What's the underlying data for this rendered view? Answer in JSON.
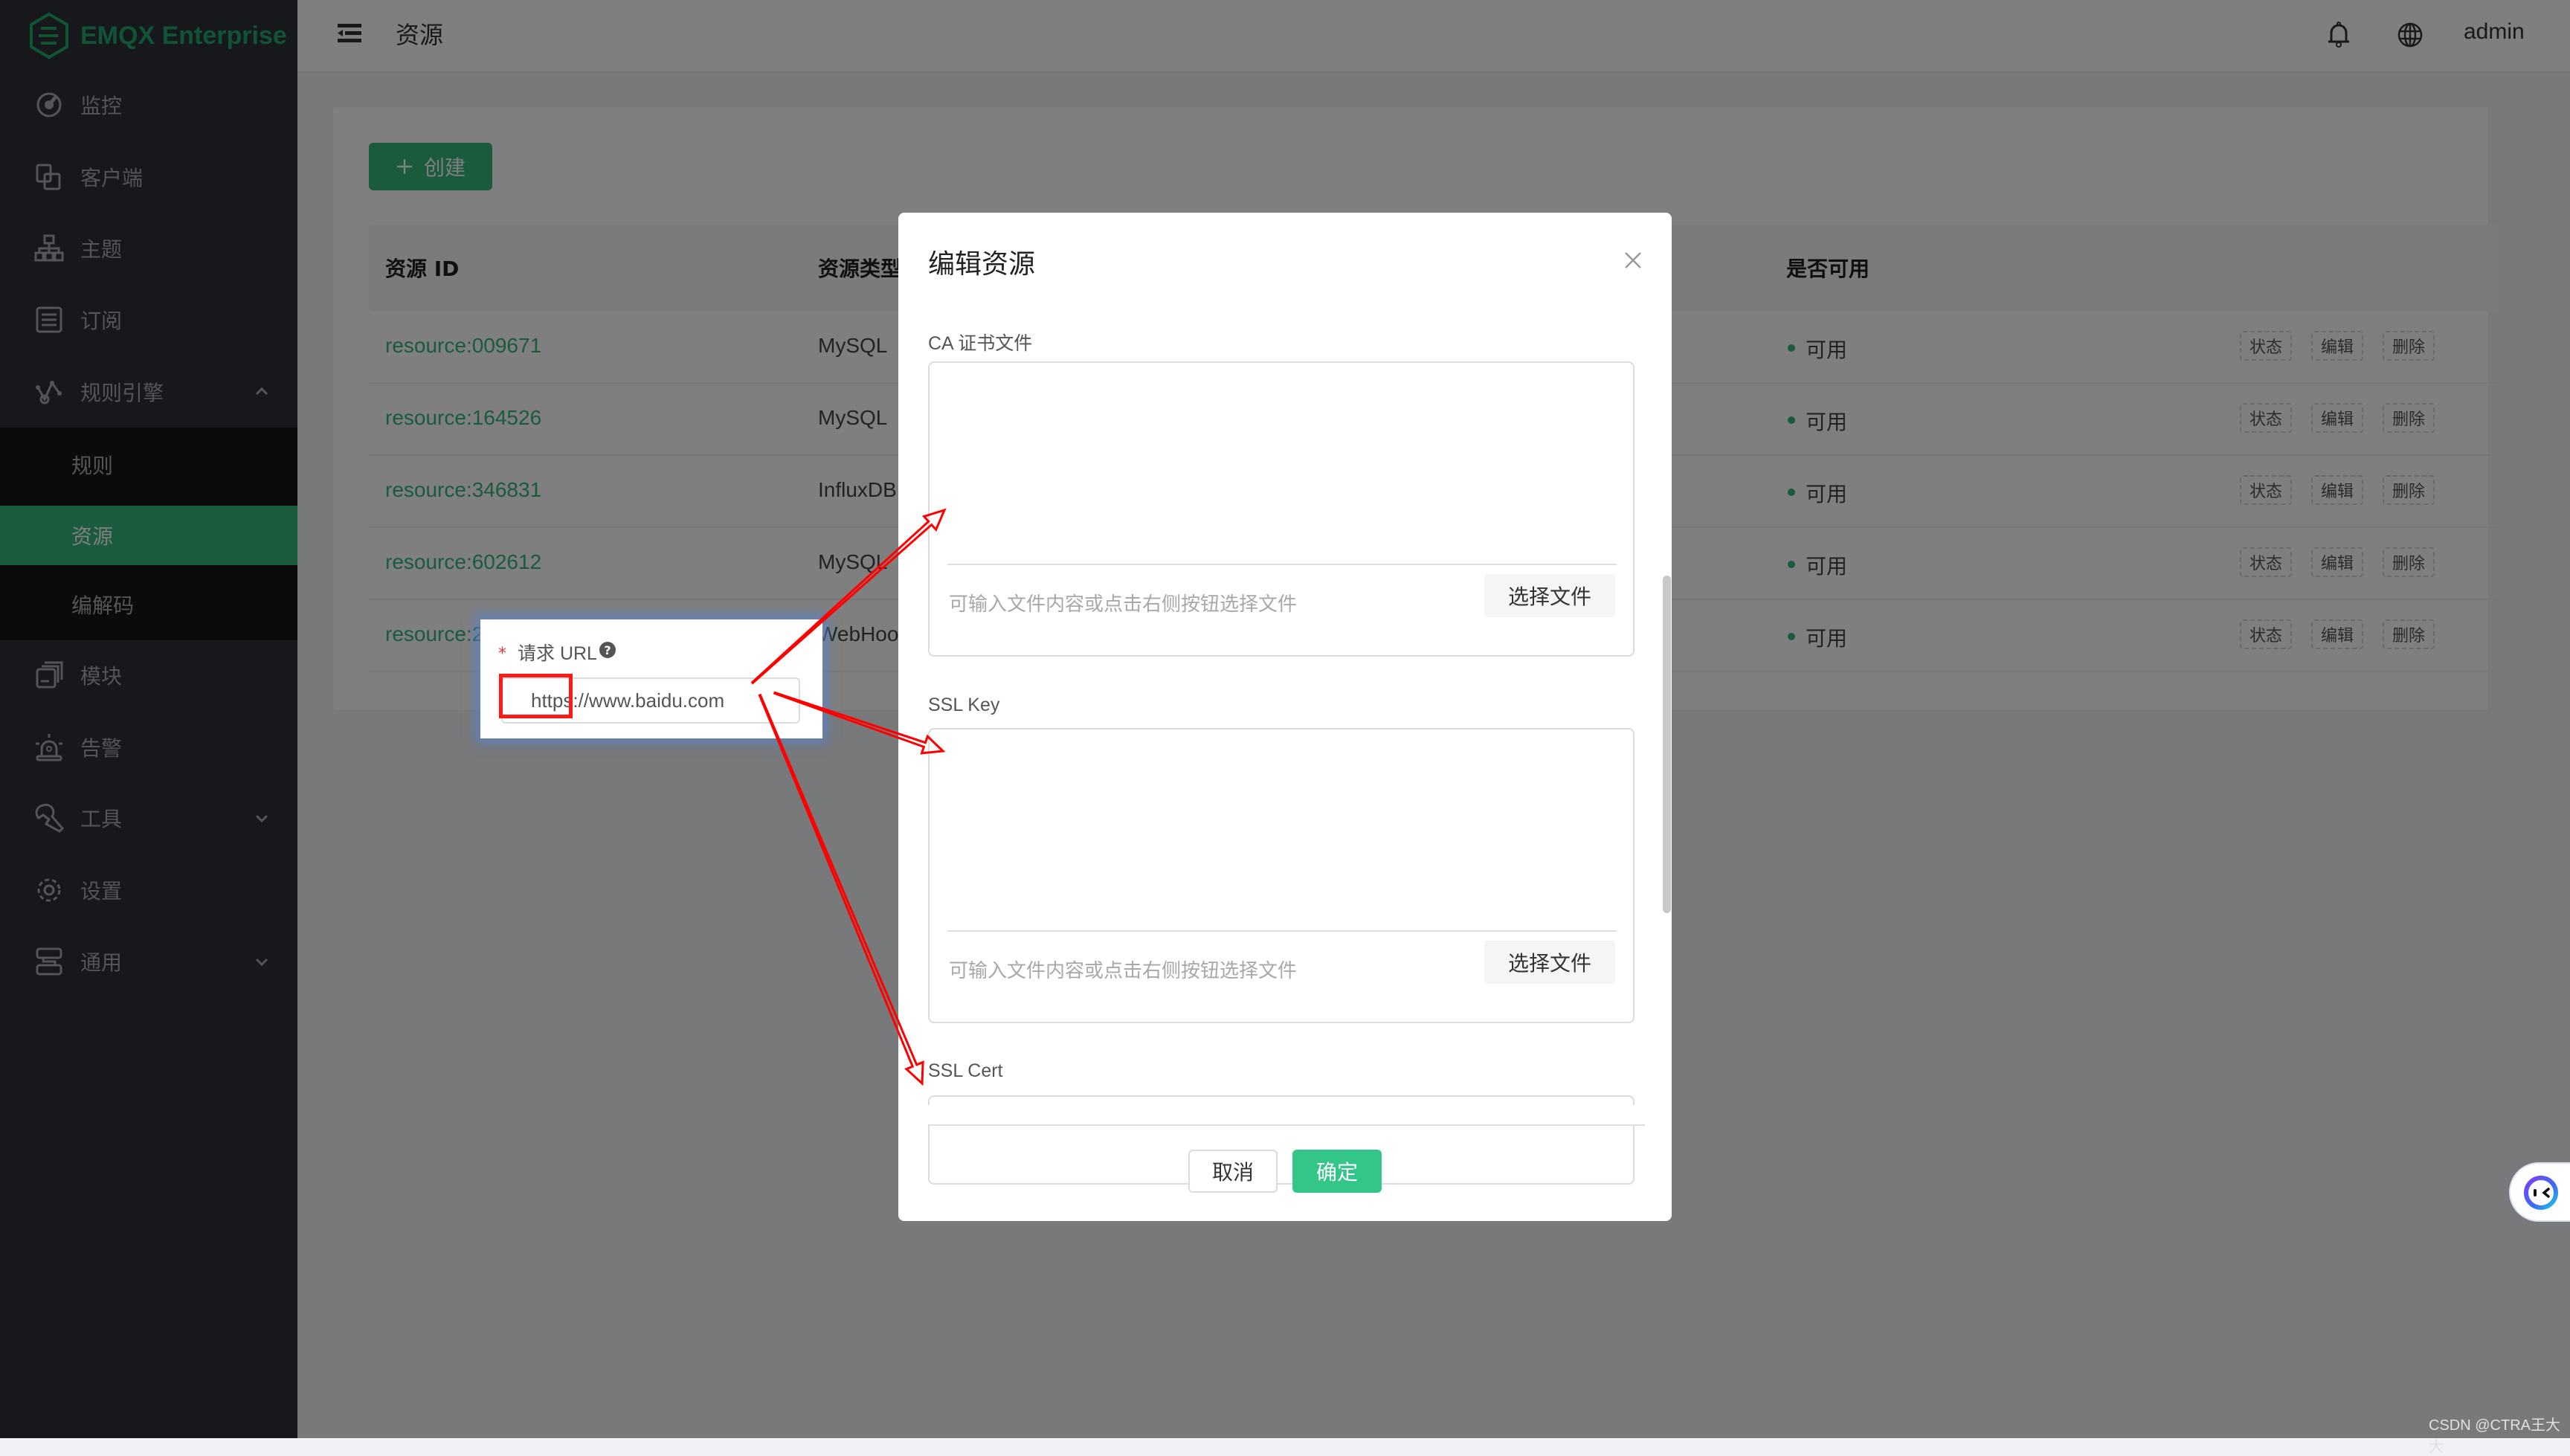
{
  "app": {
    "brand": "EMQX Enterprise",
    "accent_color": "#34b57a"
  },
  "sidebar": {
    "items": [
      {
        "label": "监控",
        "icon": "dashboard-icon"
      },
      {
        "label": "客户端",
        "icon": "clients-icon"
      },
      {
        "label": "主题",
        "icon": "topics-icon"
      },
      {
        "label": "订阅",
        "icon": "subscriptions-icon"
      },
      {
        "label": "规则引擎",
        "icon": "rule-engine-icon",
        "expanded": true,
        "children": [
          {
            "label": "规则"
          },
          {
            "label": "资源",
            "active": true
          },
          {
            "label": "编解码"
          }
        ]
      },
      {
        "label": "模块",
        "icon": "modules-icon"
      },
      {
        "label": "告警",
        "icon": "alarm-icon"
      },
      {
        "label": "工具",
        "icon": "tools-icon",
        "collapsible": true
      },
      {
        "label": "设置",
        "icon": "settings-icon"
      },
      {
        "label": "通用",
        "icon": "general-icon",
        "collapsible": true
      }
    ]
  },
  "header": {
    "title": "资源",
    "user": "admin"
  },
  "content": {
    "create_label": "创建",
    "columns": {
      "id": "资源 ID",
      "type": "资源类型",
      "available": "是否可用"
    },
    "rows": [
      {
        "id": "resource:009671",
        "type": "MySQL",
        "available": "可用"
      },
      {
        "id": "resource:164526",
        "type": "MySQL",
        "available": "可用"
      },
      {
        "id": "resource:346831",
        "type": "InfluxDB",
        "available": "可用"
      },
      {
        "id": "resource:602612",
        "type": "MySQL",
        "available": "可用"
      },
      {
        "id": "resource:2",
        "type": "WebHook",
        "available": "可用"
      }
    ],
    "actions": {
      "status": "状态",
      "edit": "编辑",
      "delete": "删除"
    }
  },
  "modal": {
    "title": "编辑资源",
    "fields": [
      {
        "label": "CA 证书文件",
        "placeholder": "可输入文件内容或点击右侧按钮选择文件",
        "button": "选择文件"
      },
      {
        "label": "SSL Key",
        "placeholder": "可输入文件内容或点击右侧按钮选择文件",
        "button": "选择文件"
      },
      {
        "label": "SSL Cert"
      }
    ],
    "cancel_label": "取消",
    "confirm_label": "确定"
  },
  "popup": {
    "required_mark": "*",
    "label": "请求 URL",
    "help": "?",
    "url_value": "https://www.baidu.com"
  },
  "annotation": {
    "color": "#ff0000"
  },
  "watermark": "CSDN @CTRA王大大"
}
